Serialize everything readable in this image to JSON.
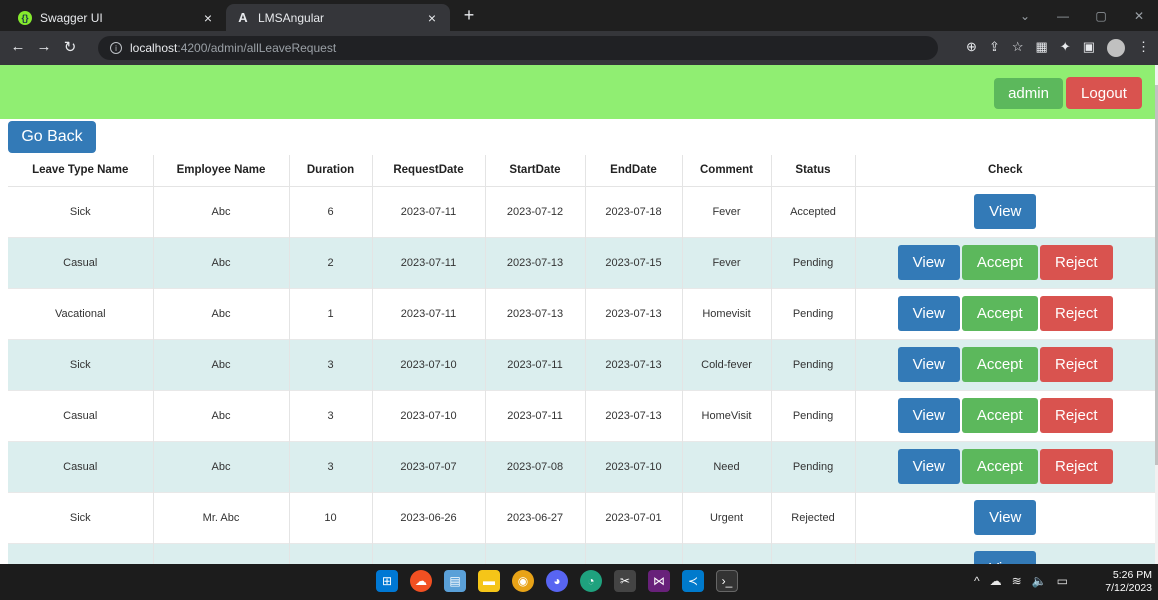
{
  "browser": {
    "tabs": [
      {
        "label": "Swagger UI",
        "icon": "swagger-icon"
      },
      {
        "label": "LMSAngular",
        "icon": "angular-icon"
      }
    ],
    "url_host": "localhost",
    "url_path": ":4200/admin/allLeaveRequest"
  },
  "header": {
    "admin_label": "admin",
    "logout_label": "Logout",
    "colors": {
      "header_bg": "#90ee72",
      "admin": "#5cb85c",
      "logout": "#d9534f"
    }
  },
  "page": {
    "go_back_label": "Go Back"
  },
  "table": {
    "columns": [
      "Leave Type Name",
      "Employee Name",
      "Duration",
      "RequestDate",
      "StartDate",
      "EndDate",
      "Comment",
      "Status",
      "Check"
    ],
    "rows": [
      {
        "leave_type": "Sick",
        "employee": "Abc",
        "duration": "6",
        "request_date": "2023-07-11",
        "start_date": "2023-07-12",
        "end_date": "2023-07-18",
        "comment": "Fever",
        "status": "Accepted",
        "actions": [
          "View"
        ]
      },
      {
        "leave_type": "Casual",
        "employee": "Abc",
        "duration": "2",
        "request_date": "2023-07-11",
        "start_date": "2023-07-13",
        "end_date": "2023-07-15",
        "comment": "Fever",
        "status": "Pending",
        "actions": [
          "View",
          "Accept",
          "Reject"
        ]
      },
      {
        "leave_type": "Vacational",
        "employee": "Abc",
        "duration": "1",
        "request_date": "2023-07-11",
        "start_date": "2023-07-13",
        "end_date": "2023-07-13",
        "comment": "Homevisit",
        "status": "Pending",
        "actions": [
          "View",
          "Accept",
          "Reject"
        ]
      },
      {
        "leave_type": "Sick",
        "employee": "Abc",
        "duration": "3",
        "request_date": "2023-07-10",
        "start_date": "2023-07-11",
        "end_date": "2023-07-13",
        "comment": "Cold-fever",
        "status": "Pending",
        "actions": [
          "View",
          "Accept",
          "Reject"
        ]
      },
      {
        "leave_type": "Casual",
        "employee": "Abc",
        "duration": "3",
        "request_date": "2023-07-10",
        "start_date": "2023-07-11",
        "end_date": "2023-07-13",
        "comment": "HomeVisit",
        "status": "Pending",
        "actions": [
          "View",
          "Accept",
          "Reject"
        ]
      },
      {
        "leave_type": "Casual",
        "employee": "Abc",
        "duration": "3",
        "request_date": "2023-07-07",
        "start_date": "2023-07-08",
        "end_date": "2023-07-10",
        "comment": "Need",
        "status": "Pending",
        "actions": [
          "View",
          "Accept",
          "Reject"
        ]
      },
      {
        "leave_type": "Sick",
        "employee": "Mr. Abc",
        "duration": "10",
        "request_date": "2023-06-26",
        "start_date": "2023-06-27",
        "end_date": "2023-07-01",
        "comment": "Urgent",
        "status": "Rejected",
        "actions": [
          "View"
        ]
      },
      {
        "leave_type": "",
        "employee": "",
        "duration": "",
        "request_date": "",
        "start_date": "",
        "end_date": "",
        "comment": "",
        "status": "",
        "actions": [
          "View"
        ]
      }
    ],
    "action_colors": {
      "View": "#337ab7",
      "Accept": "#5cb85c",
      "Reject": "#d9534f"
    }
  },
  "taskbar": {
    "time": "5:26 PM",
    "date": "7/12/2023"
  }
}
